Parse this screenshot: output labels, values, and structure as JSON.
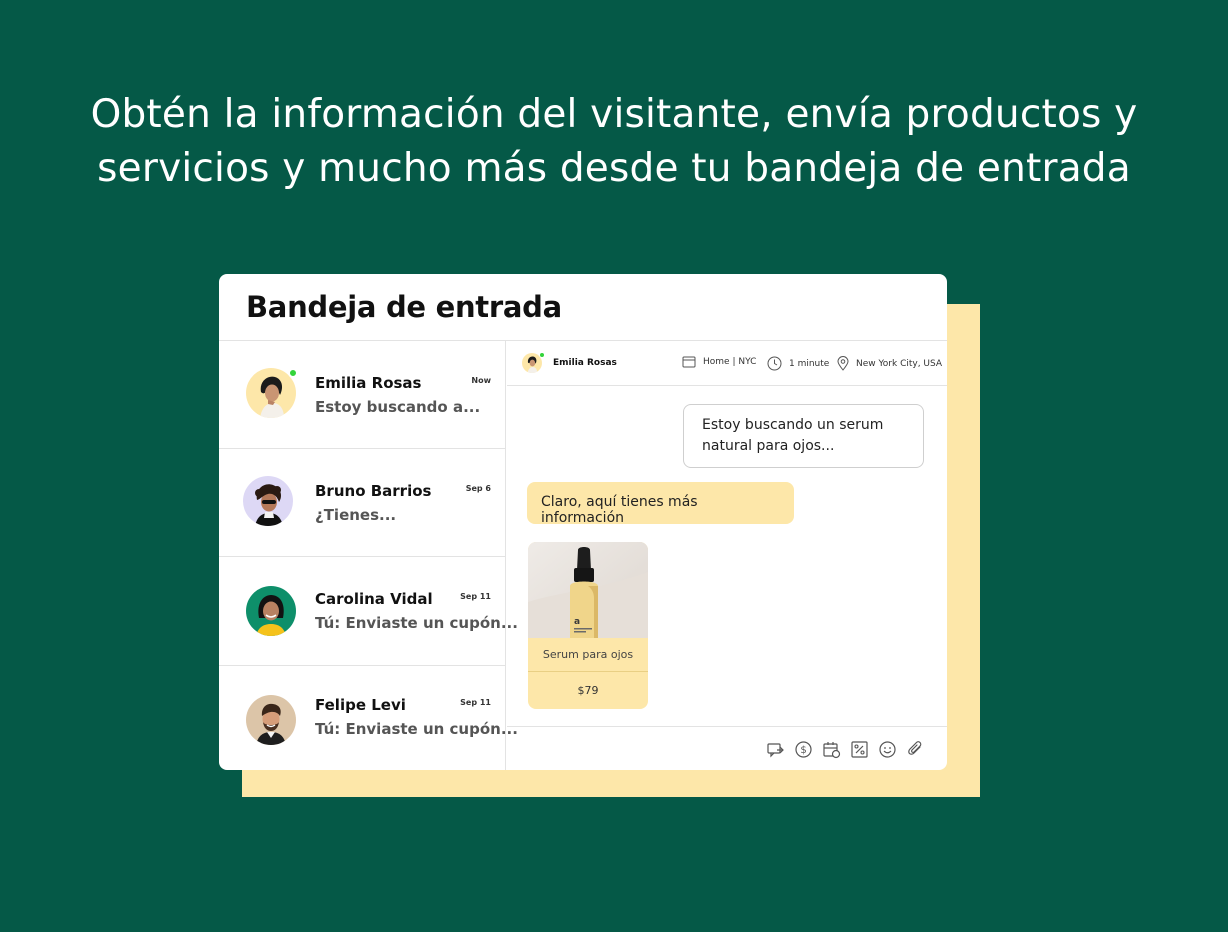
{
  "headline": {
    "line1": "Obtén la información del visitante, envía productos y",
    "line2": "servicios y mucho más desde tu bandeja de entrada"
  },
  "inbox": {
    "title": "Bandeja de entrada",
    "conversations": [
      {
        "name": "Emilia Rosas",
        "preview": "Estoy buscando a...",
        "time": "Now",
        "online": true
      },
      {
        "name": "Bruno Barrios",
        "preview": "¿Tienes...",
        "time": "Sep 6",
        "online": false
      },
      {
        "name": "Carolina Vidal",
        "preview": "Tú: Enviaste un cupón...",
        "time": "Sep 11",
        "online": false
      },
      {
        "name": "Felipe Levi",
        "preview": "Tú: Enviaste un cupón...",
        "time": "Sep 11",
        "online": false
      }
    ]
  },
  "chat": {
    "contact_name": "Emilia Rosas",
    "page": "Home | NYC",
    "duration": "1 minute",
    "location": "New York City, USA",
    "messages": {
      "visitor": "Estoy buscando un serum natural para ojos...",
      "agent": "Claro, aquí tienes más información"
    },
    "product": {
      "name": "Serum para ojos",
      "price": "$79",
      "brand": "a"
    },
    "toolbar_icons": [
      "reply-icon",
      "payment-icon",
      "booking-icon",
      "coupon-icon",
      "emoji-icon",
      "attachment-icon"
    ]
  },
  "colors": {
    "background": "#055947",
    "accent_yellow": "#fde7a9",
    "online": "#33d43a"
  }
}
